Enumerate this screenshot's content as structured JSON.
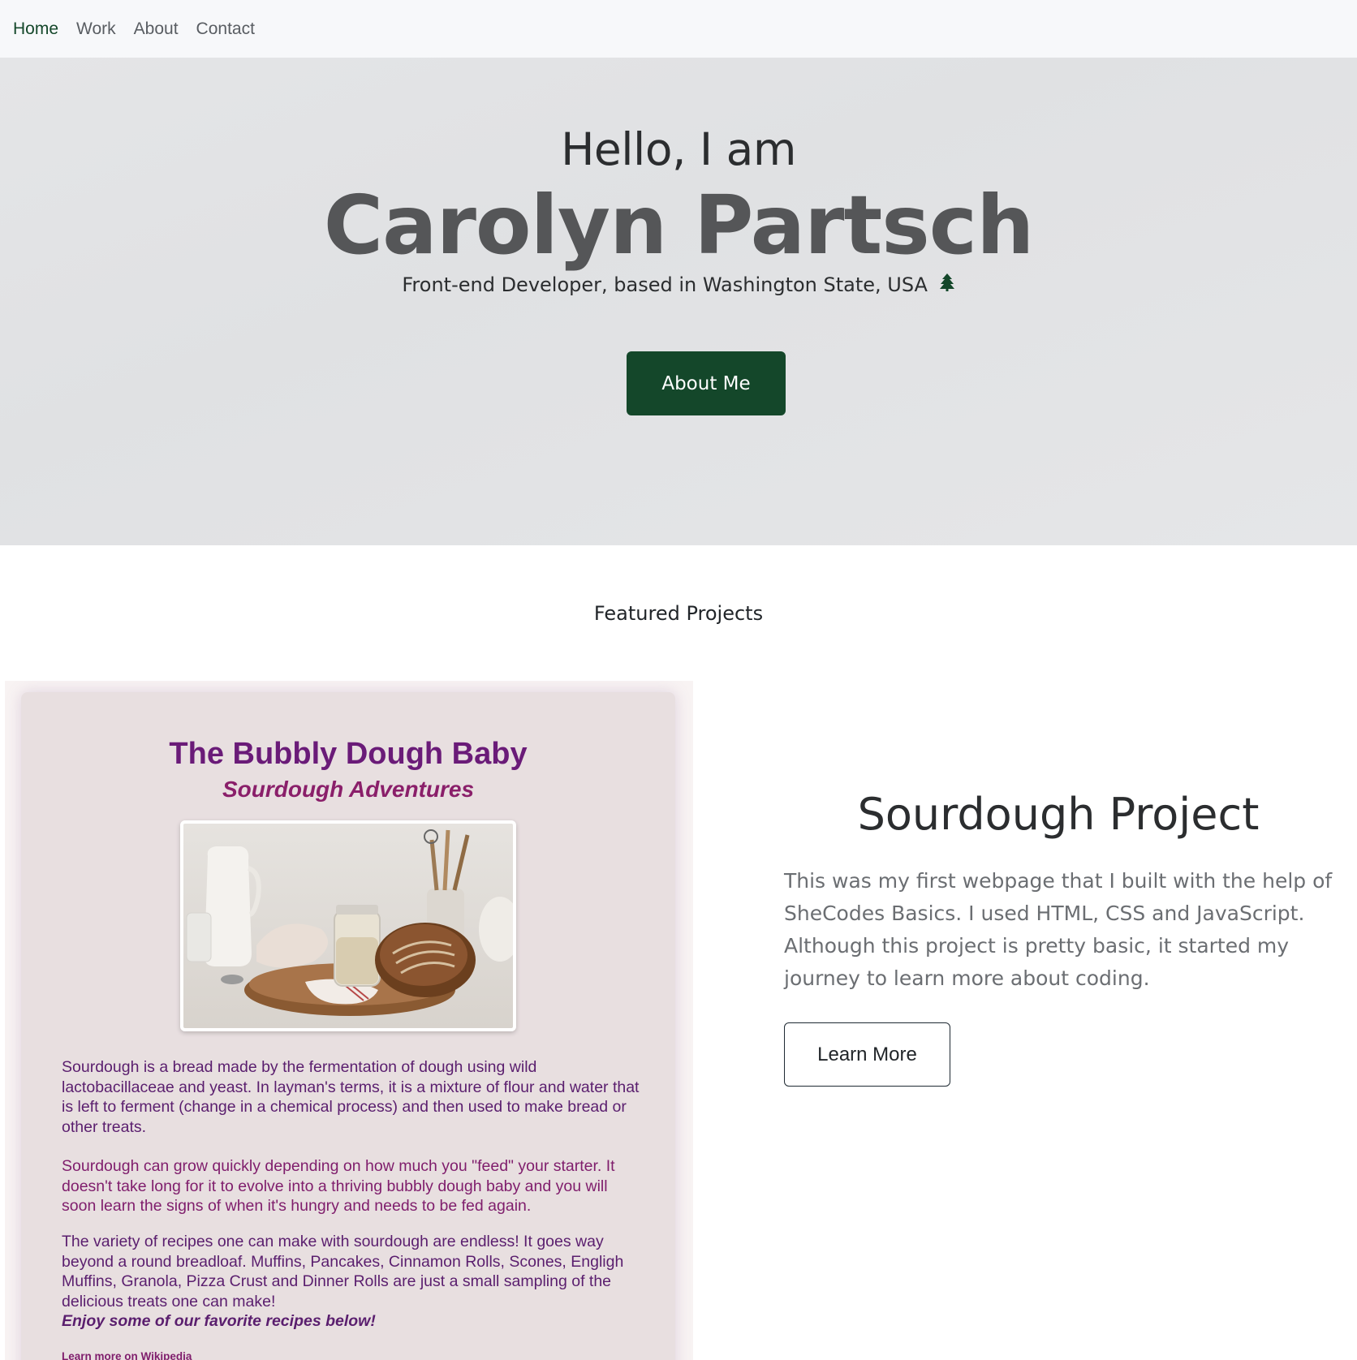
{
  "nav": {
    "items": [
      {
        "label": "Home",
        "active": true
      },
      {
        "label": "Work",
        "active": false
      },
      {
        "label": "About",
        "active": false
      },
      {
        "label": "Contact",
        "active": false
      }
    ]
  },
  "hero": {
    "greeting": "Hello, I am",
    "name": "Carolyn Partsch",
    "subtitle": "Front-end Developer, based in Washington State, USA",
    "subtitle_icon": "evergreen-tree-icon",
    "cta_label": "About Me"
  },
  "featured": {
    "title": "Featured Projects"
  },
  "project": {
    "title": "Sourdough Project",
    "description": "This was my first webpage that I built with the help of SheCodes Basics. I used HTML, CSS and JavaScript. Although this project is pretty basic, it started my journey to learn more about coding.",
    "button_label": "Learn More",
    "screenshot": {
      "title": "The Bubbly Dough Baby",
      "subtitle": "Sourdough Adventures",
      "photo": "sourdough-bread-and-starter-jar-photo",
      "paragraph1": "Sourdough is a bread made by the fermentation of dough using wild lactobacillaceae and yeast. In layman's terms, it is a mixture of flour and water that is left to ferment (change in a chemical process) and then used to make bread or other treats.",
      "paragraph2": "Sourdough can grow quickly depending on how much you \"feed\" your starter. It doesn't take long for it to evolve into a thriving bubbly dough baby and you will soon learn the signs of when it's hungry and needs to be fed again.",
      "paragraph3": "The variety of recipes one can make with sourdough are endless! It goes way beyond a round breadloaf. Muffins, Pancakes, Cinnamon Rolls, Scones, Engligh Muffins, Granola, Pizza Crust and Dinner Rolls are just a small sampling of the delicious treats one can make!",
      "emphasis": "Enjoy some of our favorite recipes below!",
      "link": "Learn more on Wikipedia"
    }
  },
  "colors": {
    "accent_green": "#14472a",
    "screenshot_purple": "#6a1b78"
  }
}
